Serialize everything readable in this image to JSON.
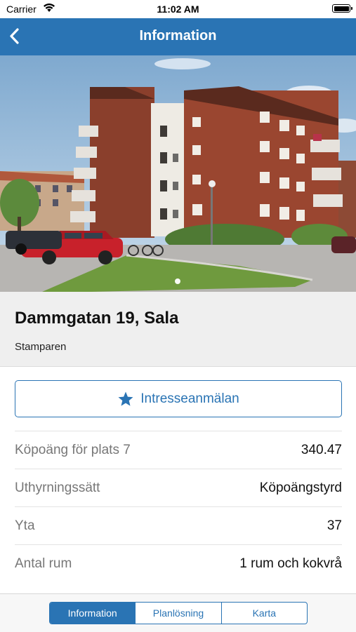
{
  "status_bar": {
    "carrier": "Carrier",
    "time": "11:02 AM"
  },
  "nav": {
    "title": "Information",
    "back_icon": "chevron-left-icon"
  },
  "hero": {
    "image": "apartment-building-photo",
    "page_index": 1,
    "page_count": 1
  },
  "listing": {
    "address": "Dammgatan 19, Sala",
    "area": "Stamparen"
  },
  "interest": {
    "label": "Intresseanmälan",
    "icon": "star-icon"
  },
  "details": [
    {
      "label": "Köpoäng för plats 7",
      "value": "340.47"
    },
    {
      "label": "Uthyrningssätt",
      "value": "Köpoängstyrd"
    },
    {
      "label": "Yta",
      "value": "37"
    },
    {
      "label": "Antal rum",
      "value": "1 rum och kokvrå"
    }
  ],
  "tabs": [
    {
      "label": "Information",
      "active": true
    },
    {
      "label": "Planlösning",
      "active": false
    },
    {
      "label": "Karta",
      "active": false
    }
  ],
  "colors": {
    "accent": "#2a74b4",
    "address_bg": "#efefef"
  }
}
